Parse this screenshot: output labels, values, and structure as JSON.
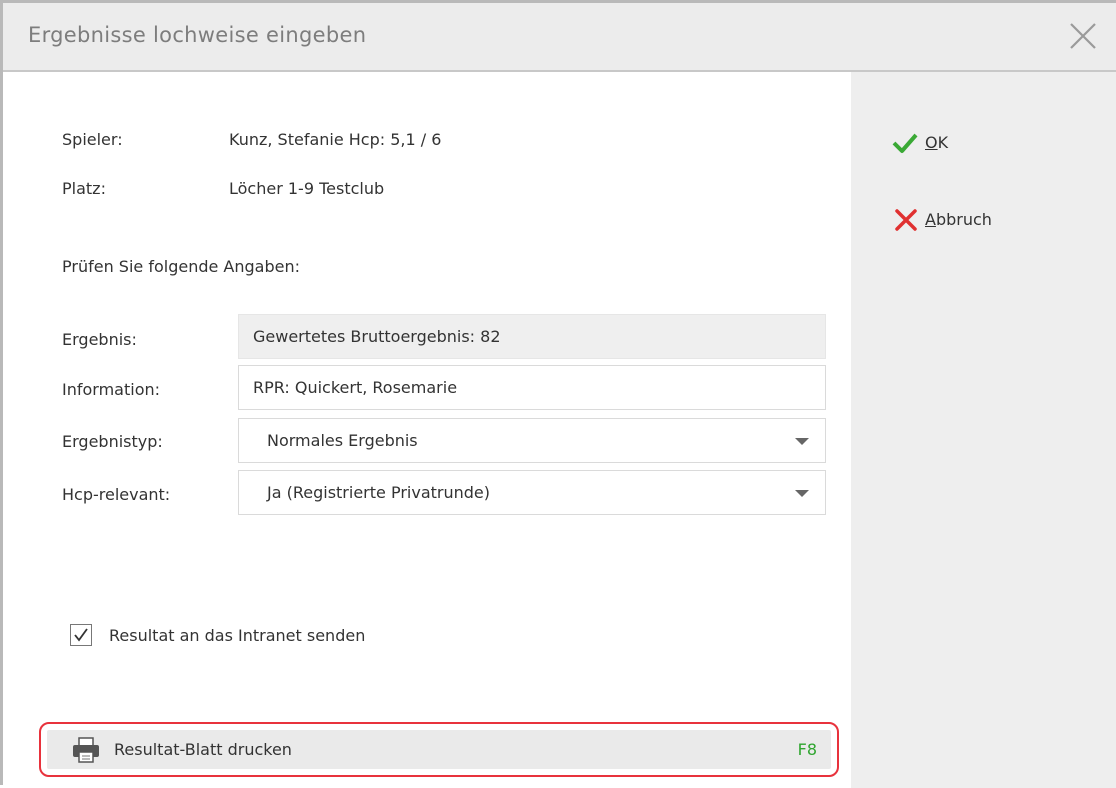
{
  "window": {
    "title": "Ergebnisse lochweise eingeben"
  },
  "info": {
    "player_label": "Spieler:",
    "player_value": "Kunz, Stefanie Hcp: 5,1 / 6",
    "course_label": "Platz:",
    "course_value": "Löcher 1-9 Testclub",
    "check_prompt": "Prüfen Sie folgende Angaben:"
  },
  "form": {
    "result_label": "Ergebnis:",
    "result_value": "Gewertetes Bruttoergebnis: 82",
    "information_label": "Information:",
    "information_value": "RPR: Quickert, Rosemarie",
    "result_type_label": "Ergebnistyp:",
    "result_type_value": "Normales Ergebnis",
    "hcp_relevant_label": "Hcp-relevant:",
    "hcp_relevant_value": "Ja (Registrierte Privatrunde)"
  },
  "intranet": {
    "label": "Resultat an das Intranet senden",
    "checked": true
  },
  "print": {
    "label": "Resultat-Blatt drucken",
    "shortcut": "F8",
    "highlight_color": "#e8323c"
  },
  "side": {
    "ok_mnemonic": "O",
    "ok_rest": "K",
    "cancel_mnemonic": "A",
    "cancel_rest": "bbruch",
    "ok_color": "#3aa935",
    "cancel_color": "#e03030"
  },
  "icons": {
    "close": "close-icon",
    "ok": "check-icon",
    "cancel": "x-icon",
    "print": "printer-icon",
    "checkbox": "checkmark-icon"
  }
}
